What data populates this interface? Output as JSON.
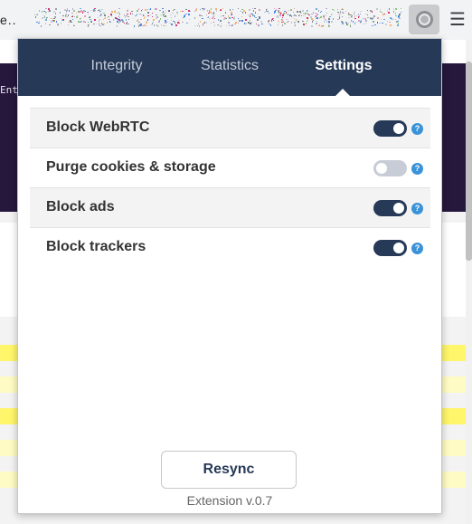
{
  "browser": {
    "url_text": "e..",
    "menu_glyph": "☰",
    "extension_icon": "gear-icon"
  },
  "page": {
    "header_text": "Ent"
  },
  "popup": {
    "tabs": [
      {
        "label": "Integrity",
        "active": false
      },
      {
        "label": "Statistics",
        "active": false
      },
      {
        "label": "Settings",
        "active": true
      }
    ],
    "settings": [
      {
        "label": "Block WebRTC",
        "enabled": true,
        "help": "?"
      },
      {
        "label": "Purge cookies & storage",
        "enabled": false,
        "help": "?"
      },
      {
        "label": "Block ads",
        "enabled": true,
        "help": "?"
      },
      {
        "label": "Block trackers",
        "enabled": true,
        "help": "?"
      }
    ],
    "resync_label": "Resync",
    "version_text": "Extension v.0.7"
  },
  "colors": {
    "tab_bar": "#263957",
    "toggle_on": "#263957",
    "toggle_off": "#c7ccd6",
    "help_icon": "#3a93d8",
    "page_header": "#26173d"
  }
}
